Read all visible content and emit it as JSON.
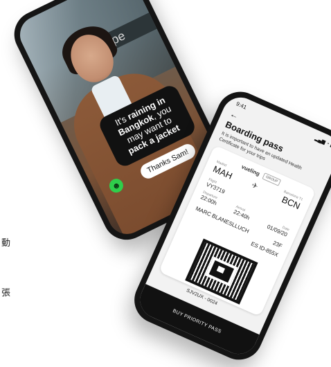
{
  "side_text": {
    "char1": "動",
    "char2": "張"
  },
  "phone1": {
    "sign_text": "pe",
    "message_line1_prefix": "It's ",
    "message_line1_bold": "raining in",
    "message_line2_bold": "Bangkok",
    "message_line2_rest": ", you",
    "message_line3": "may want to",
    "message_line4_bold": "pack a jacket",
    "reply": "Thanks Sam!",
    "avatar_glyph": "☻"
  },
  "phone2": {
    "time": "9:41",
    "status_icons": "▂▄▆ ◔ ▮",
    "back": "←",
    "title": "Boarding pass",
    "subtitle": "It is important to have an updated Health Certificate for your trips",
    "airline": "vueling",
    "badge": "GROUP",
    "origin_label": "Madrid",
    "origin": "MAH",
    "dest_label": "Barcelona T1",
    "dest": "BCN",
    "flight_label": "Flight",
    "flight": "VY3719",
    "dep_label": "Departure",
    "dep": "22:00h",
    "arr_label": "Arrival",
    "arr": "22:40h",
    "date_label": "Date",
    "date": "01/09/20",
    "passenger": "MARC BLANESLLUCH",
    "seat": "23F",
    "doc": "ES ID-855X",
    "pnr": "SJV2UX - 0024",
    "buy_button": "BUY PRIORITY PASS"
  }
}
